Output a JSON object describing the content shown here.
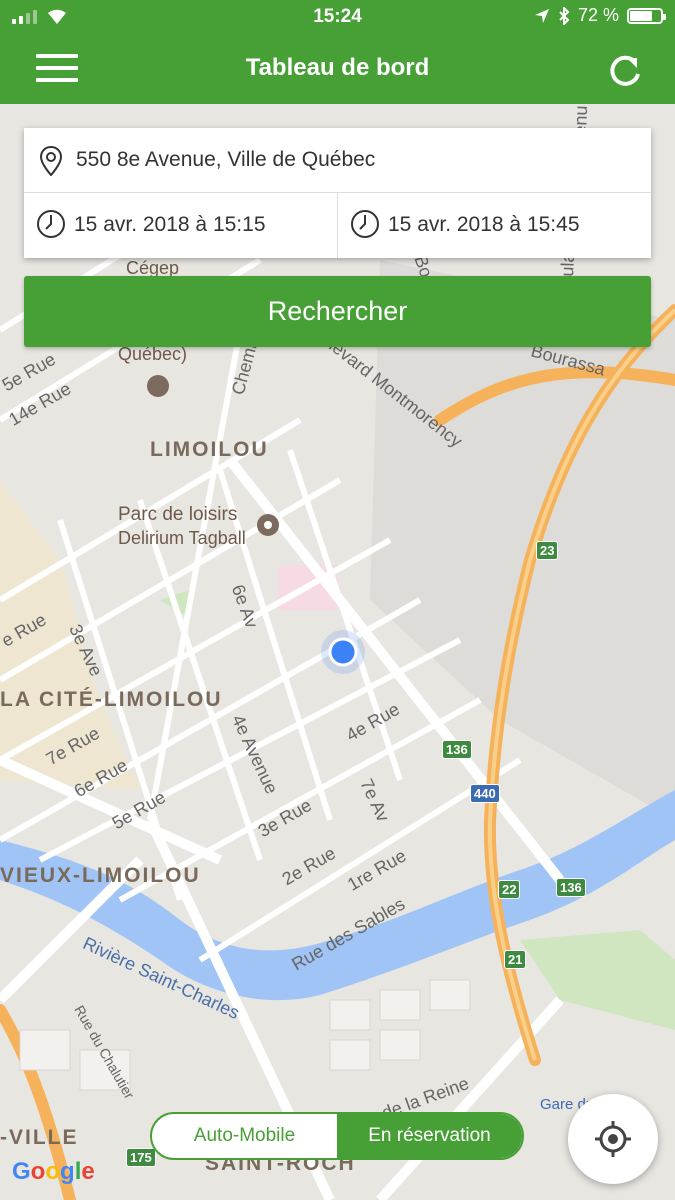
{
  "status_bar": {
    "time": "15:24",
    "battery": "72 %",
    "battery_level": 0.72,
    "icons": [
      "signal-icon",
      "wifi-icon",
      "location-arrow-icon",
      "bluetooth-icon",
      "battery-icon"
    ]
  },
  "app_bar": {
    "title": "Tableau de bord",
    "menu_icon": "hamburger-menu-icon",
    "refresh_icon": "refresh-icon"
  },
  "search": {
    "address": "550 8e Avenue, Ville de Québec",
    "start": "15 avr. 2018 à 15:15",
    "end": "15 avr. 2018 à 15:45",
    "button": "Rechercher"
  },
  "map": {
    "districts": [
      "LIMOILOU",
      "LA CITÉ-LIMOILOU",
      "VIEUX-LIMOILOU",
      "SAINT-ROCH",
      "-VILLE"
    ],
    "pois": [
      "Cégep",
      "Québec)",
      "Parc de loisirs",
      "Delirium Tagball",
      "Gare du Palais"
    ],
    "streets": [
      "Chemin",
      "ulevard Montmorency",
      "Bourassa",
      "Bo",
      "ula",
      "enu",
      "14e Rue",
      "5e Rue",
      "e Rue",
      "6e Av",
      "3e Ave",
      "4e Avenue",
      "4e Rue",
      "7e Rue",
      "6e Rue",
      "5e Rue",
      "3e Rue",
      "7e Av",
      "2e Rue",
      "1re Rue",
      "Rue des Sables",
      "Rivière Saint-Charles",
      "Rue du Chalutier",
      "de la Reine"
    ],
    "shields": [
      "23",
      "136",
      "440",
      "22",
      "21",
      "136",
      "175"
    ],
    "attribution": "Google"
  },
  "mode": {
    "option_a": "Auto-Mobile",
    "option_b": "En réservation",
    "selected": "En réservation"
  },
  "colors": {
    "primary": "#46a035",
    "water": "#9fc4f5",
    "highway": "#f5b25b",
    "location_dot": "#3b82f6"
  }
}
